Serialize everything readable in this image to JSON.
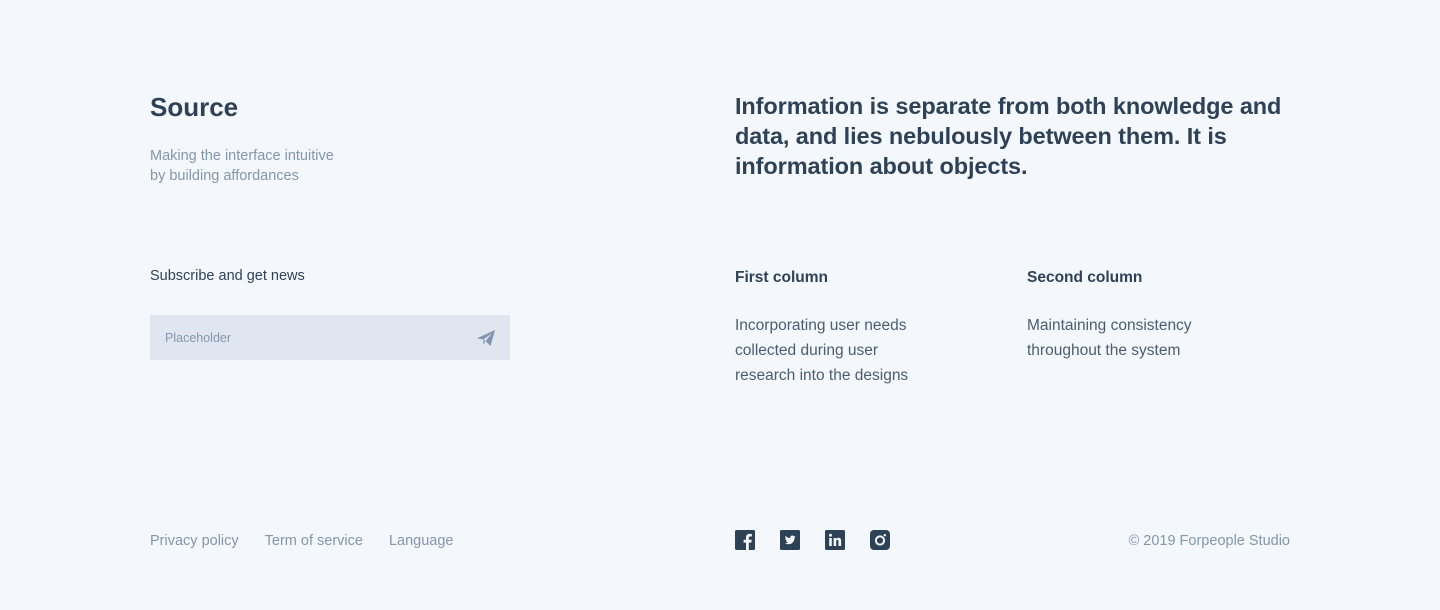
{
  "brand": {
    "title": "Source",
    "tagline_line1": "Making the interface intuitive",
    "tagline_line2": "by building affordances"
  },
  "subscribe": {
    "label": "Subscribe and get news",
    "placeholder": "Placeholder",
    "value": "",
    "send_icon": "paper-plane-icon"
  },
  "quote": {
    "text": "Information is separate from both knowledge and data, and lies nebulously between them. It is information about objects."
  },
  "columns": [
    {
      "title": "First column",
      "lines": [
        "Incorporating user needs",
        "collected during user",
        "research into the designs"
      ]
    },
    {
      "title": "Second column",
      "lines": [
        "Maintaining consistency",
        "throughout the system"
      ]
    }
  ],
  "footer": {
    "links": [
      "Privacy policy",
      "Term of service",
      "Language"
    ],
    "social_icons": [
      "facebook-icon",
      "twitter-icon",
      "linkedin-icon",
      "instagram-icon"
    ],
    "copyright": "© 2019 Forpeople Studio"
  },
  "colors": {
    "background": "#f4f7fb",
    "text_dark": "#2e4257",
    "text_muted": "#8396ad",
    "input_background": "#dfe6ef"
  }
}
